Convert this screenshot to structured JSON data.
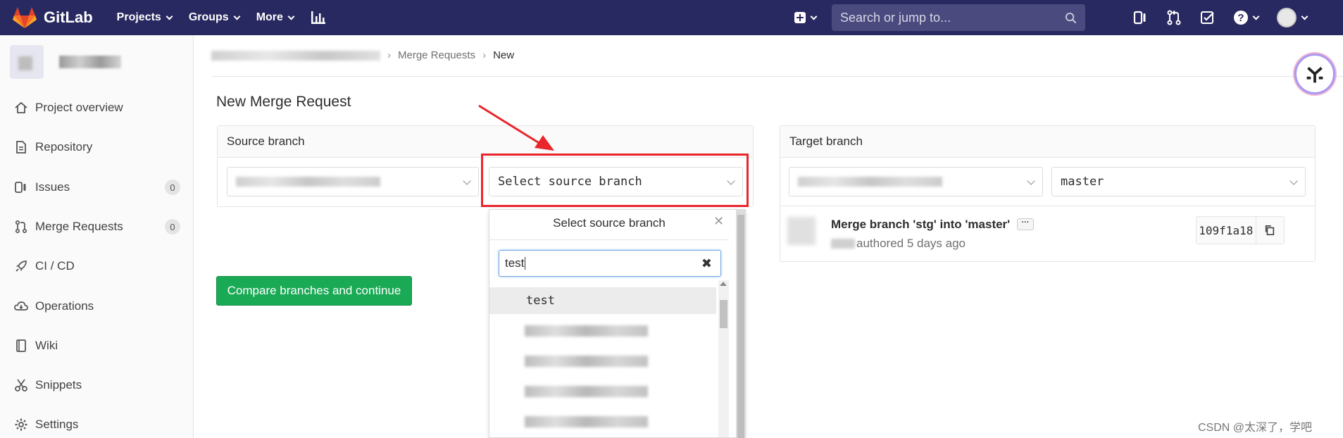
{
  "brand": {
    "name": "GitLab",
    "accent": "#292961",
    "logo_color": "#e24329"
  },
  "nav": {
    "items": [
      {
        "label": "Projects"
      },
      {
        "label": "Groups"
      },
      {
        "label": "More"
      }
    ],
    "search_placeholder": "Search or jump to..."
  },
  "sidebar": {
    "items": [
      {
        "label": "Project overview",
        "icon": "home-icon"
      },
      {
        "label": "Repository",
        "icon": "document-icon"
      },
      {
        "label": "Issues",
        "icon": "issues-icon",
        "count": "0"
      },
      {
        "label": "Merge Requests",
        "icon": "merge-request-icon",
        "count": "0"
      },
      {
        "label": "CI / CD",
        "icon": "rocket-icon"
      },
      {
        "label": "Operations",
        "icon": "cloud-icon"
      },
      {
        "label": "Wiki",
        "icon": "book-icon"
      },
      {
        "label": "Snippets",
        "icon": "scissors-icon"
      },
      {
        "label": "Settings",
        "icon": "gear-icon"
      }
    ]
  },
  "breadcrumb": {
    "items": [
      "Merge Requests",
      "New"
    ]
  },
  "page": {
    "title": "New Merge Request",
    "source": {
      "heading": "Source branch",
      "branch_placeholder": "Select source branch"
    },
    "target": {
      "heading": "Target branch",
      "branch": "master"
    },
    "compare_button": "Compare branches and continue"
  },
  "dropdown": {
    "title": "Select source branch",
    "search_value": "test",
    "items": [
      "test"
    ]
  },
  "commit": {
    "message": "Merge branch 'stg' into 'master'",
    "meta": "authored 5 days ago",
    "sha": "109f1a18"
  },
  "annotation": {
    "color": "#e8262c"
  },
  "watermark": "CSDN @太深了，学吧"
}
